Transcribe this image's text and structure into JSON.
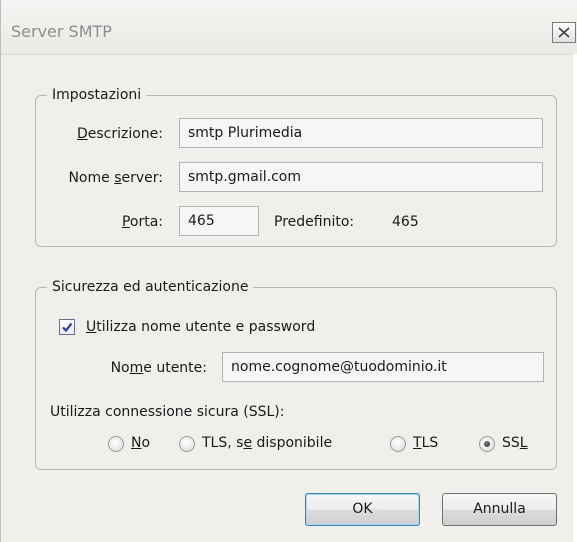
{
  "window": {
    "title": "Server SMTP",
    "close_icon": "close-x-icon"
  },
  "settings_group": {
    "legend": "Impostazioni",
    "description": {
      "label_underlined": "D",
      "label_rest": "escrizione:",
      "value": "smtp Plurimedia"
    },
    "server_name": {
      "label_before": "Nome ",
      "label_underlined": "s",
      "label_rest": "erver:",
      "value": "smtp.gmail.com"
    },
    "port": {
      "label_underlined": "P",
      "label_rest": "orta:",
      "value": "465",
      "default_label": "Predefinito:",
      "default_value": "465"
    }
  },
  "security_group": {
    "legend": "Sicurezza ed autenticazione",
    "use_auth": {
      "label_underlined": "U",
      "label_rest": "tilizza nome utente e password",
      "checked": true
    },
    "username": {
      "label_before": "No",
      "label_underlined": "m",
      "label_rest": "e utente:",
      "value": "nome.cognome@tuodominio.it"
    },
    "secure_connection_label": "Utilizza connessione sicura (SSL):",
    "options": [
      {
        "before": "",
        "underlined": "N",
        "after": "o",
        "selected": false
      },
      {
        "before": "TLS, s",
        "underlined": "e",
        "after": " disponibile",
        "selected": false
      },
      {
        "before": "",
        "underlined": "T",
        "after": "LS",
        "selected": false
      },
      {
        "before": "SS",
        "underlined": "L",
        "after": "",
        "selected": true
      }
    ]
  },
  "buttons": {
    "ok": "OK",
    "cancel": "Annulla"
  },
  "colors": {
    "dialog_bg": "#f1efeb",
    "default_button_border": "#3c7fb1"
  }
}
